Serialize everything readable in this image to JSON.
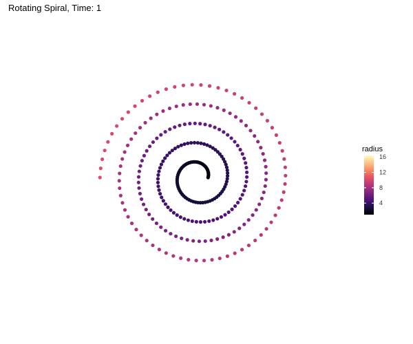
{
  "chart_data": {
    "type": "scatter",
    "title": "Rotating Spiral, Time: 1",
    "xlabel": "",
    "ylabel": "",
    "grid": false,
    "axes_visible": false,
    "legend": {
      "title": "radius",
      "placement": "right",
      "ticks": [
        4,
        8,
        12,
        16
      ],
      "range": [
        1,
        16.4
      ],
      "colormap": "magma",
      "stops": [
        "#000004",
        "#1c1044",
        "#4f127b",
        "#812581",
        "#b5367a",
        "#e55064",
        "#fb8761",
        "#fec287",
        "#fcfdbf"
      ]
    },
    "spiral": {
      "turns": 4.5,
      "r_start": 1.1,
      "r_end": 10.2,
      "angle_start_deg": 0,
      "direction": "counterclockwise",
      "point_count": 300
    }
  }
}
